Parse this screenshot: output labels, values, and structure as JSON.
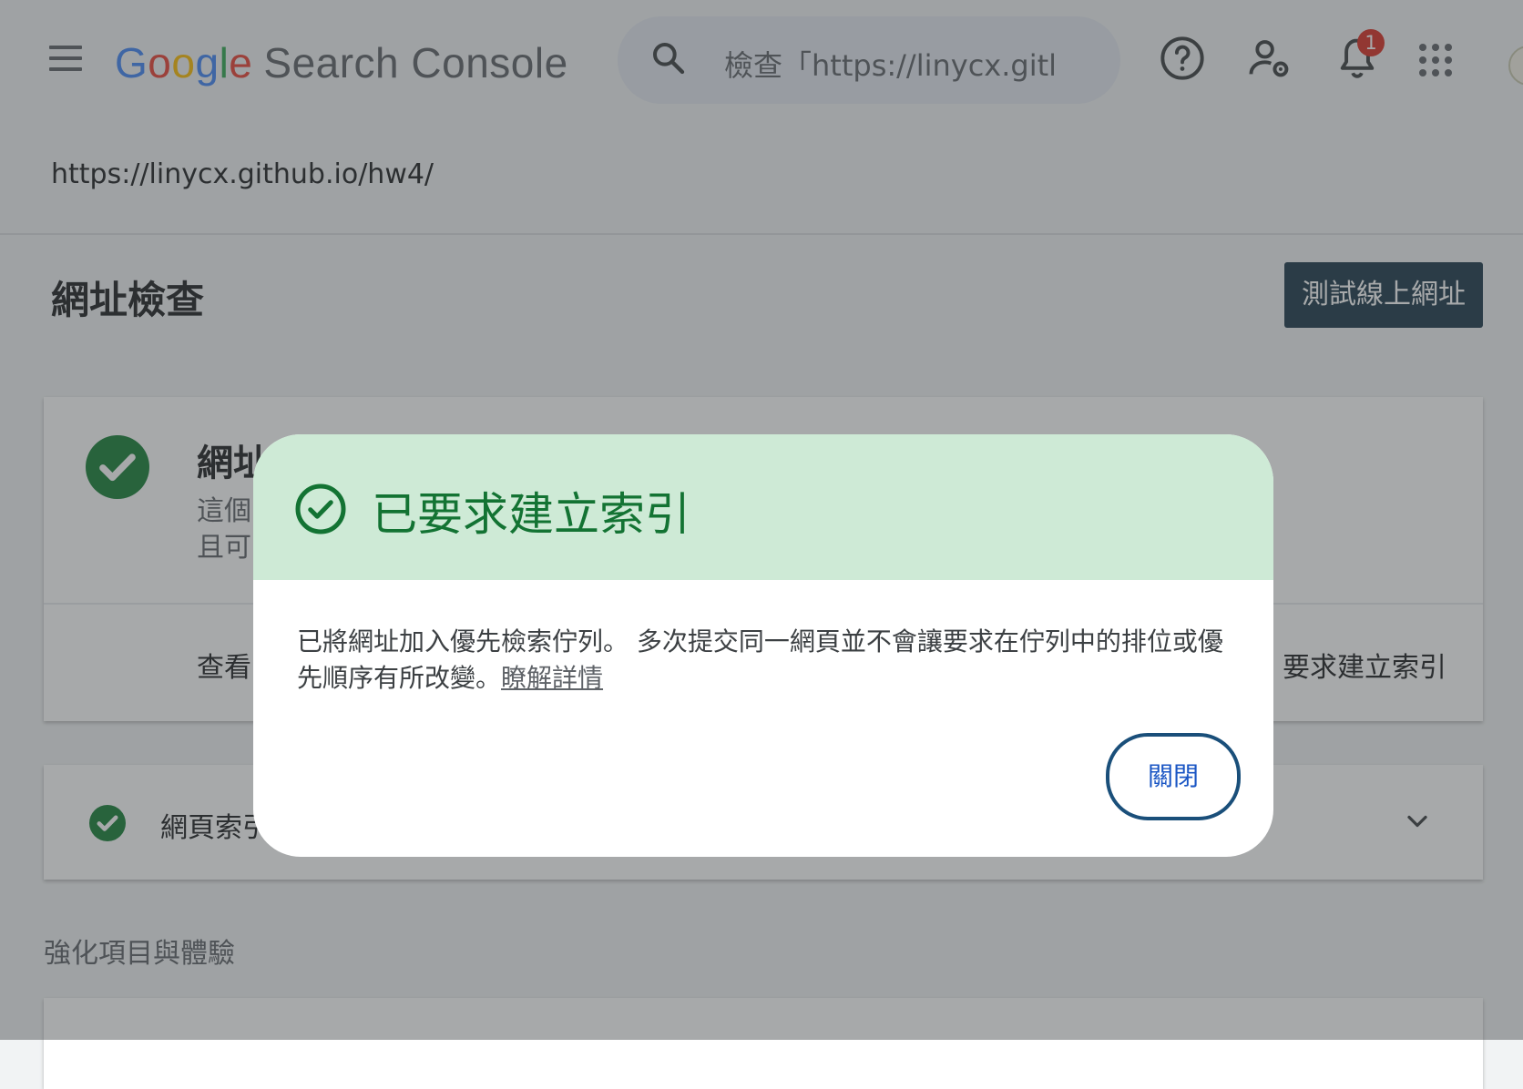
{
  "header": {
    "logo_letters": [
      "G",
      "o",
      "o",
      "g",
      "l",
      "e"
    ],
    "product": "Search Console",
    "search_text": "檢查「https://linycx.gitl",
    "notification_count": "1",
    "icons": [
      "menu-icon",
      "search-icon",
      "help-icon",
      "manage-users-icon",
      "bell-icon",
      "apps-icon",
      "account-avatar"
    ]
  },
  "property": {
    "url": "https://linycx.github.io/hw4/"
  },
  "page": {
    "title": "網址檢查",
    "test_live_button": "測試線上網址"
  },
  "status_card": {
    "title": "網址",
    "desc_line1": "這個",
    "desc_line2": "且可",
    "view_link": "查看",
    "request_index_link": "要求建立索引"
  },
  "index_card": {
    "label": "網頁索引"
  },
  "enhancements": {
    "section_title": "強化項目與體驗"
  },
  "dialog": {
    "title": "已要求建立索引",
    "body_line1": "已將網址加入優先檢索佇列。 多次提交同一網頁並不會讓要求在佇列中的排位或優",
    "body_line2": "先順序有所改變。",
    "learn_more": "瞭解詳情",
    "close_button": "關閉"
  },
  "colors": {
    "dialog_header_bg": "#ceead6",
    "success_green": "#137333",
    "check_green": "#188038",
    "primary_button_bg": "#1e3a4c",
    "badge_red": "#d93025",
    "close_button_text": "#1a56c4"
  }
}
